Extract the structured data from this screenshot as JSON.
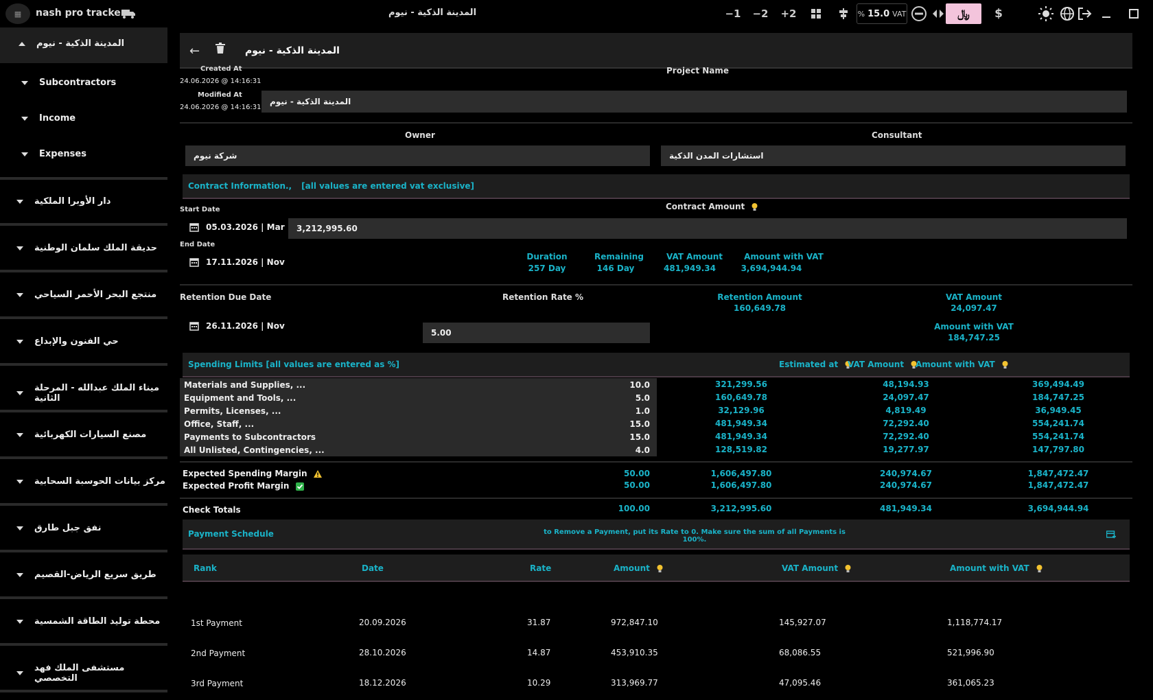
{
  "app": {
    "name": "nash pro tracker",
    "window_title": "المدينة الذكية - نيوم"
  },
  "toolbar": {
    "minus1": "−1",
    "minus2": "−2",
    "plus2": "+2",
    "vat_rate": "15.0",
    "vat_prefix": "%",
    "vat_label": "VAT",
    "sar_symbol": "﷼",
    "dollar": "$"
  },
  "sidebar": {
    "active_project": "المدينة الذكية - نيوم",
    "sub_items": [
      "Subcontractors",
      "Income",
      "Expenses"
    ],
    "projects": [
      "دار الأوبرا الملكية",
      "حديقة الملك سلمان الوطنية",
      "منتجع البحر الأحمر السياحي",
      "حي الفنون والإبداع",
      "ميناء الملك عبدالله - المرحلة الثانية",
      "مصنع السيارات الكهربائية",
      "مركز بيانات الحوسبة السحابية",
      "نفق جبل طارق",
      "طريق سريع الرياض-القصيم",
      "محطة توليد الطاقة الشمسية",
      "مستشفى الملك فهد التخصصي"
    ]
  },
  "header": {
    "title": "المدينة الذكية - نيوم"
  },
  "meta": {
    "created_label": "Created At",
    "created_value": "24.06.2026 @ 14:16:31",
    "modified_label": "Modified At",
    "modified_value": "24.06.2026 @ 14:16:31"
  },
  "project": {
    "name_label": "Project Name",
    "name_value": "المدينة الذكية - نيوم",
    "owner_label": "Owner",
    "owner_value": "شركة نيوم",
    "consultant_label": "Consultant",
    "consultant_value": "استشارات المدن الذكية"
  },
  "contract": {
    "bar_title": "Contract Information.,",
    "bar_note": "[all values are entered vat exclusive]",
    "start_label": "Start Date",
    "start_value": "05.03.2026 | Mar",
    "end_label": "End Date",
    "end_value": "17.11.2026 | Nov",
    "amount_label": "Contract Amount",
    "amount_value": "3,212,995.60",
    "duration_label": "Duration",
    "duration_value": "257 Day",
    "remaining_label": "Remaining",
    "remaining_value": "146 Day",
    "vat_label": "VAT Amount",
    "vat_value": "481,949.34",
    "with_vat_label": "Amount with VAT",
    "with_vat_value": "3,694,944.94"
  },
  "retention": {
    "due_label": "Retention Due Date",
    "due_value": "26.11.2026 | Nov",
    "rate_label": "Retention Rate %",
    "rate_value": "5.00",
    "amount_label": "Retention Amount",
    "amount_value": "160,649.78",
    "vat_label": "VAT Amount",
    "vat_value": "24,097.47",
    "with_vat_label": "Amount with VAT",
    "with_vat_value": "184,747.25"
  },
  "limits": {
    "bar_title": "Spending Limits [all values are entered as %]",
    "col_est": "Estimated at",
    "col_vat": "VAT Amount",
    "col_with_vat": "Amount with VAT",
    "rows": [
      {
        "name": "Materials and Supplies, ...",
        "pct": "10.0",
        "est": "321,299.56",
        "vat": "48,194.93",
        "total": "369,494.49"
      },
      {
        "name": "Equipment and Tools, ...",
        "pct": "5.0",
        "est": "160,649.78",
        "vat": "24,097.47",
        "total": "184,747.25"
      },
      {
        "name": "Permits, Licenses, ...",
        "pct": "1.0",
        "est": "32,129.96",
        "vat": "4,819.49",
        "total": "36,949.45"
      },
      {
        "name": "Office, Staff, ...",
        "pct": "15.0",
        "est": "481,949.34",
        "vat": "72,292.40",
        "total": "554,241.74"
      },
      {
        "name": "Payments to Subcontractors",
        "pct": "15.0",
        "est": "481,949.34",
        "vat": "72,292.40",
        "total": "554,241.74"
      },
      {
        "name": "All Unlisted, Contingencies, ...",
        "pct": "4.0",
        "est": "128,519.82",
        "vat": "19,277.97",
        "total": "147,797.80"
      }
    ],
    "spending_margin": {
      "label": "Expected Spending Margin",
      "pct": "50.00",
      "est": "1,606,497.80",
      "vat": "240,974.67",
      "total": "1,847,472.47"
    },
    "profit_margin": {
      "label": "Expected Profit Margin",
      "pct": "50.00",
      "est": "1,606,497.80",
      "vat": "240,974.67",
      "total": "1,847,472.47"
    },
    "totals": {
      "label": "Check Totals",
      "pct": "100.00",
      "est": "3,212,995.60",
      "vat": "481,949.34",
      "total": "3,694,944.94"
    }
  },
  "payments": {
    "bar_title": "Payment Schedule",
    "bar_note": "to Remove a Payment, put its Rate to 0. Make sure the sum of all Payments is 100%.",
    "headers": {
      "rank": "Rank",
      "date": "Date",
      "rate": "Rate",
      "amount": "Amount",
      "vat": "VAT Amount",
      "with_vat": "Amount with VAT"
    },
    "rows": [
      {
        "rank": "1st Payment",
        "date": "20.09.2026",
        "rate": "31.87",
        "amount": "972,847.10",
        "vat": "145,927.07",
        "total": "1,118,774.17"
      },
      {
        "rank": "2nd Payment",
        "date": "28.10.2026",
        "rate": "14.87",
        "amount": "453,910.35",
        "vat": "68,086.55",
        "total": "521,996.90"
      },
      {
        "rank": "3rd Payment",
        "date": "18.12.2026",
        "rate": "10.29",
        "amount": "313,969.77",
        "vat": "47,095.46",
        "total": "361,065.23"
      }
    ]
  }
}
